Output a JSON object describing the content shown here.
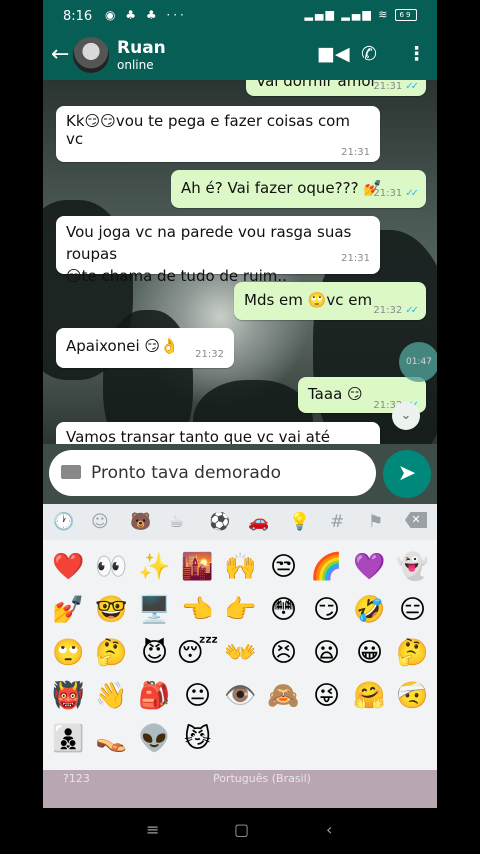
{
  "status": {
    "time": "8:16",
    "battery": "69"
  },
  "contact": {
    "name": "Ruan",
    "status": "online"
  },
  "messages": [
    {
      "dir": "out",
      "text": "Vai dormir amor",
      "emoji": "",
      "time": "21:31",
      "ticks": "✓✓"
    },
    {
      "dir": "in",
      "text": "vou te pega e fazer coisas com vc",
      "prefix": "Kk",
      "emoji": "😏😏",
      "time": "21:31"
    },
    {
      "dir": "out",
      "text": "Ah é? Vai fazer oque???",
      "emoji": "💅",
      "time": "21:31",
      "ticks": "✓✓"
    },
    {
      "dir": "in",
      "text": "Vou joga vc na parede vou rasga suas roupas",
      "line2": "te chama de tudo de ruim..",
      "emoji": "😏",
      "time": "21:31"
    },
    {
      "dir": "out",
      "text": "Mds em",
      "emoji": "🙄",
      "suffix": "vc em",
      "time": "21:32",
      "ticks": "✓✓"
    },
    {
      "dir": "in",
      "text": "Apaixonei",
      "emoji": "😏👌",
      "time": "21:32"
    },
    {
      "dir": "out",
      "text": "Taaa",
      "emoji": "😏",
      "time": "21:32",
      "ticks": "✓✓"
    },
    {
      "dir": "in",
      "text": "Vamos transar tanto que vc vai até desmaiar"
    }
  ],
  "overlay": {
    "time": "01:47"
  },
  "input": {
    "value": "Pronto tava demorado"
  },
  "emoji_categories": [
    "🕐",
    "☺",
    "🐻",
    "☕",
    "⚽",
    "🚗",
    "💡",
    "#",
    "⚑"
  ],
  "emojis": [
    "❤️",
    "👀",
    "✨",
    "🌇",
    "🙌",
    "😒",
    "🌈",
    "💜",
    "👻",
    "💅",
    "🤓",
    "🖥️",
    "👈",
    "👉",
    "😳",
    "😏",
    "🤣",
    "😑",
    "🙄",
    "🤔",
    "😈",
    "😴",
    "👐",
    "😣",
    "😦",
    "😀",
    "🤔",
    "👹",
    "👋",
    "🎒",
    "😐",
    "👁️",
    "🙈",
    "😜",
    "🤗",
    "🤕",
    "👨‍👦‍👦",
    "👡",
    "👽",
    "😼"
  ],
  "keyboard_bottom": {
    "left": "?123",
    "lang": "Português (Brasil)"
  }
}
